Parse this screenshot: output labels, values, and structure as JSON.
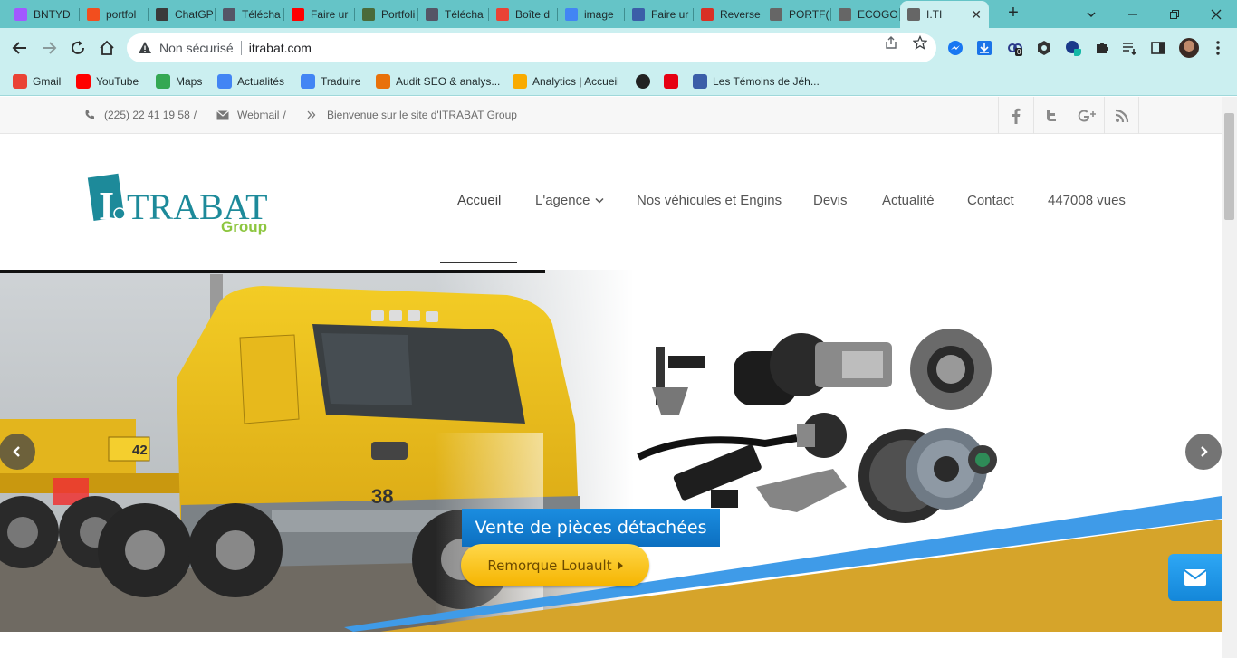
{
  "browser": {
    "tabs": [
      {
        "label": "BNTYD",
        "favicon": "figma-icon",
        "color": "#a259ff"
      },
      {
        "label": "portfol",
        "favicon": "figma-icon",
        "color": "#f24e1e"
      },
      {
        "label": "ChatGP",
        "favicon": "chatgpt-icon",
        "color": "#3a3a3a"
      },
      {
        "label": "Télécha",
        "favicon": "stack-icon",
        "color": "#556"
      },
      {
        "label": "Faire ur",
        "favicon": "youtube-icon",
        "color": "#ff0000"
      },
      {
        "label": "Portfoli",
        "favicon": "profile-icon",
        "color": "#4a6b3a"
      },
      {
        "label": "Télécha",
        "favicon": "stack-icon",
        "color": "#556"
      },
      {
        "label": "Boîte d",
        "favicon": "gmail-icon",
        "color": "#ea4335"
      },
      {
        "label": "image",
        "favicon": "google-icon",
        "color": "#4285f4"
      },
      {
        "label": "Faire ur",
        "favicon": "jw-icon",
        "color": "#3b5ea8"
      },
      {
        "label": "Reverse",
        "favicon": "reverse-icon",
        "color": "#d93025"
      },
      {
        "label": "PORTF(",
        "favicon": "globe-icon",
        "color": "#666"
      },
      {
        "label": "ECOGO",
        "favicon": "globe-icon",
        "color": "#666"
      },
      {
        "label": "I.TI",
        "favicon": "globe-icon",
        "color": "#666",
        "active": true
      }
    ],
    "new_tab": "+",
    "security_label": "Non sécurisé",
    "url": "itrabat.com",
    "ext_badge": "0",
    "bookmarks": [
      {
        "label": "Gmail",
        "icon": "gmail-icon",
        "color": "#ea4335"
      },
      {
        "label": "YouTube",
        "icon": "youtube-icon",
        "color": "#ff0000"
      },
      {
        "label": "Maps",
        "icon": "maps-icon",
        "color": "#34a853"
      },
      {
        "label": "Actualités",
        "icon": "news-icon",
        "color": "#4285f4"
      },
      {
        "label": "Traduire",
        "icon": "translate-icon",
        "color": "#4285f4"
      },
      {
        "label": "Audit SEO & analys...",
        "icon": "seo-icon",
        "color": "#e8710a"
      },
      {
        "label": "Analytics | Accueil",
        "icon": "analytics-icon",
        "color": "#f9ab00"
      },
      {
        "label": "",
        "icon": "globe-icon",
        "color": "#222"
      },
      {
        "label": "",
        "icon": "huawei-icon",
        "color": "#e60012"
      },
      {
        "label": "Les Témoins de Jéh...",
        "icon": "jw-icon",
        "color": "#3b5ea8"
      }
    ]
  },
  "site": {
    "topbar": {
      "phone": "(225) 22 41 19 58",
      "webmail": "Webmail",
      "welcome": "Bienvenue sur le site d'ITRABAT Group",
      "separator": "/"
    },
    "logo": {
      "main": "TRABAT",
      "initial": "I",
      "sub": "Group"
    },
    "nav": [
      "Accueil",
      "L'agence",
      "Nos véhicules et Engins",
      "Devis",
      "Actualité",
      "Contact",
      "447008 vues"
    ],
    "slider": {
      "caption": "Vente de pièces détachées",
      "button": "Remorque Louault",
      "truck_number": "42",
      "truck_number_2": "38"
    },
    "colors": {
      "teal": "#1d8a9a",
      "green": "#8dc63f",
      "gold": "#d6a42a",
      "blue": "#3f9be8"
    }
  }
}
